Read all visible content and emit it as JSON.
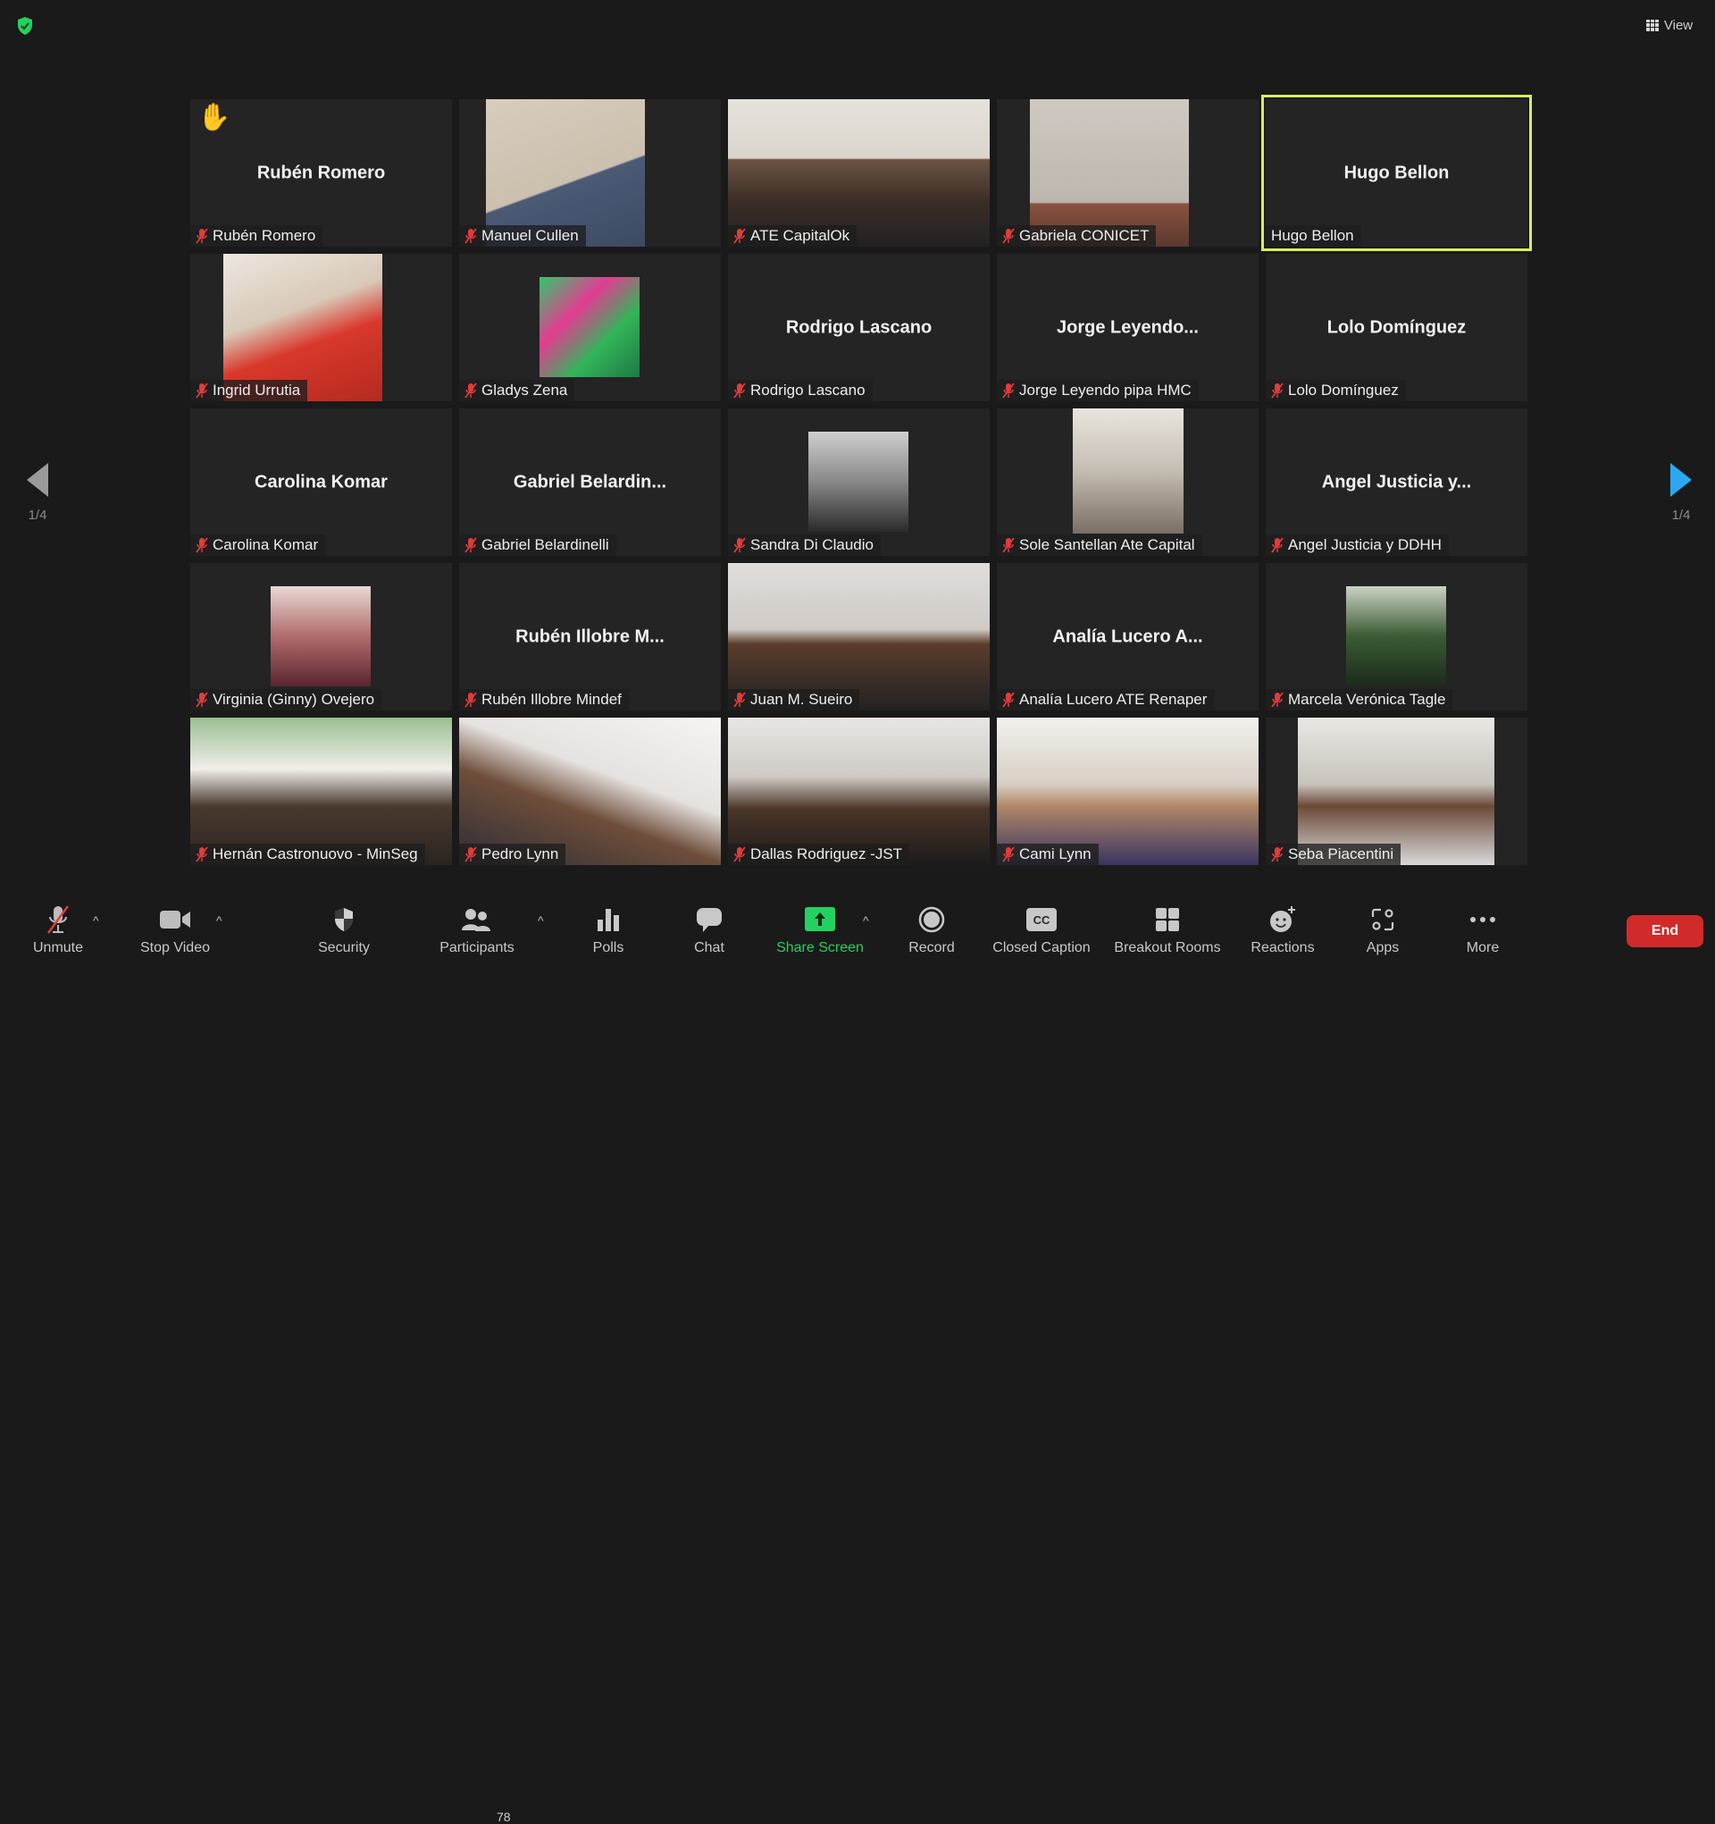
{
  "header": {
    "view_label": "View",
    "security_status_icon": "shield-check-icon"
  },
  "colors": {
    "active_speaker_border": "#d7ef5f",
    "share_green": "#23d160",
    "end_red": "#d12a2a",
    "nav_active": "#2aa9f2",
    "muted_red": "#e03c3c"
  },
  "pagination": {
    "left": "1/4",
    "right": "1/4"
  },
  "tiles": [
    {
      "display_name": "Rubén Romero",
      "label": "Rubén Romero",
      "muted": true,
      "video": "none",
      "hand_raised": true,
      "hand_icon": "✋"
    },
    {
      "display_name": "",
      "label": "Manuel Cullen",
      "muted": true,
      "video": "camera"
    },
    {
      "display_name": "",
      "label": "ATE CapitalOk",
      "muted": true,
      "video": "camera"
    },
    {
      "display_name": "",
      "label": "Gabriela CONICET",
      "muted": true,
      "video": "camera"
    },
    {
      "display_name": "Hugo Bellon",
      "label": "Hugo Bellon",
      "muted": false,
      "video": "none",
      "active_speaker": true
    },
    {
      "display_name": "",
      "label": "Ingrid Urrutia",
      "muted": true,
      "video": "camera"
    },
    {
      "display_name": "",
      "label": "Gladys Zena",
      "muted": true,
      "video": "avatar"
    },
    {
      "display_name": "Rodrigo Lascano",
      "label": "Rodrigo Lascano",
      "muted": true,
      "video": "none"
    },
    {
      "display_name": "Jorge  Leyendo...",
      "label": "Jorge Leyendo pipa HMC",
      "muted": true,
      "video": "none"
    },
    {
      "display_name": "Lolo  Domínguez",
      "label": "Lolo  Domínguez",
      "muted": true,
      "video": "none"
    },
    {
      "display_name": "Carolina Komar",
      "label": "Carolina Komar",
      "muted": true,
      "video": "none"
    },
    {
      "display_name": "Gabriel  Belardin...",
      "label": "Gabriel Belardinelli",
      "muted": true,
      "video": "none"
    },
    {
      "display_name": "",
      "label": "Sandra Di Claudio",
      "muted": true,
      "video": "avatar"
    },
    {
      "display_name": "",
      "label": "Sole Santellan Ate Capital",
      "muted": true,
      "video": "avatar"
    },
    {
      "display_name": "Angel  Justicia  y...",
      "label": "Angel Justicia y DDHH",
      "muted": true,
      "video": "none"
    },
    {
      "display_name": "",
      "label": "Virginia (Ginny) Ovejero",
      "muted": true,
      "video": "avatar"
    },
    {
      "display_name": "Rubén  Illobre  M...",
      "label": "Rubén Illobre Mindef",
      "muted": true,
      "video": "none"
    },
    {
      "display_name": "",
      "label": "Juan M. Sueiro",
      "muted": true,
      "video": "camera"
    },
    {
      "display_name": "Analía  Lucero  A...",
      "label": "Analía Lucero ATE Renaper",
      "muted": true,
      "video": "none"
    },
    {
      "display_name": "",
      "label": "Marcela Verónica Tagle",
      "muted": true,
      "video": "avatar"
    },
    {
      "display_name": "",
      "label": "Hernán Castronuovo - MinSeg",
      "muted": true,
      "video": "camera"
    },
    {
      "display_name": "",
      "label": "Pedro Lynn",
      "muted": true,
      "video": "camera"
    },
    {
      "display_name": "",
      "label": "Dallas Rodriguez -JST",
      "muted": true,
      "video": "camera"
    },
    {
      "display_name": "",
      "label": "Cami Lynn",
      "muted": true,
      "video": "camera"
    },
    {
      "display_name": "",
      "label": "Seba Piacentini",
      "muted": true,
      "video": "camera"
    }
  ],
  "toolbar": {
    "unmute": "Unmute",
    "stop_video": "Stop Video",
    "security": "Security",
    "participants": "Participants",
    "participants_count": "78",
    "polls": "Polls",
    "chat": "Chat",
    "share_screen": "Share Screen",
    "record": "Record",
    "closed_caption": "Closed Caption",
    "cc_glyph": "CC",
    "breakout_rooms": "Breakout Rooms",
    "reactions": "Reactions",
    "apps": "Apps",
    "more": "More",
    "end": "End",
    "caret": "^"
  }
}
